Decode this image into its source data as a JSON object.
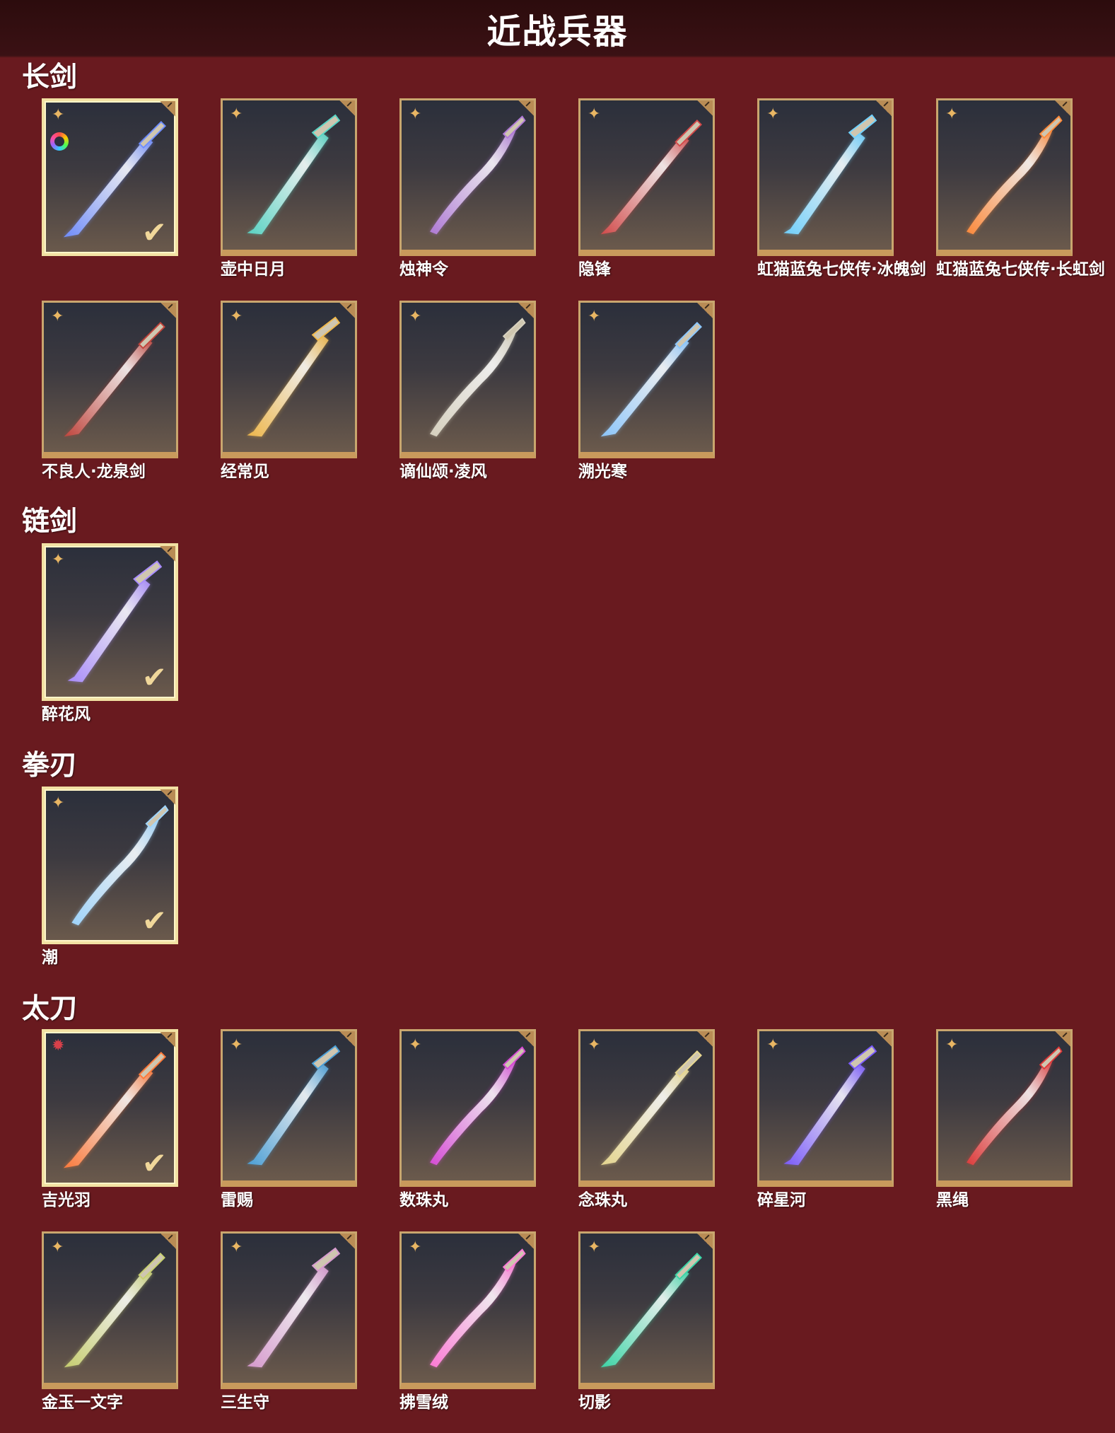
{
  "header": {
    "title": "近战兵器"
  },
  "sections": {
    "long_sword": {
      "title": "长剑",
      "items": [
        {
          "label": "",
          "selected": true,
          "icon": "blue-glowing-sword",
          "glow": "#6f8dff"
        },
        {
          "label": "壶中日月",
          "selected": false,
          "icon": "teal-jade-sword",
          "glow": "#58d6c6"
        },
        {
          "label": "烛神令",
          "selected": false,
          "icon": "purple-curved-sword",
          "glow": "#b07ad8"
        },
        {
          "label": "隐锋",
          "selected": false,
          "icon": "red-hilt-sword",
          "glow": "#d44a4a"
        },
        {
          "label": "虹猫蓝兔七侠传·冰魄剑",
          "selected": false,
          "icon": "ice-blue-sword",
          "glow": "#6fd2ff"
        },
        {
          "label": "虹猫蓝兔七侠传·长虹剑",
          "selected": false,
          "icon": "orange-flame-sword",
          "glow": "#ff8a3a"
        },
        {
          "label": "不良人·龙泉剑",
          "selected": false,
          "icon": "dark-red-sword",
          "glow": "#c2443c"
        },
        {
          "label": "经常见",
          "selected": false,
          "icon": "golden-sword",
          "glow": "#f0b84a"
        },
        {
          "label": "谪仙颂·凌风",
          "selected": false,
          "icon": "silver-sword",
          "glow": "#d8d2c0"
        },
        {
          "label": "溯光寒",
          "selected": false,
          "icon": "crystal-ice-sword",
          "glow": "#8cc8ff"
        }
      ]
    },
    "chain_sword": {
      "title": "链剑",
      "items": [
        {
          "label": "醉花风",
          "selected": true,
          "icon": "violet-chain-sword",
          "glow": "#a98cff"
        }
      ]
    },
    "fist_blade": {
      "title": "拳刃",
      "items": [
        {
          "label": "潮",
          "selected": true,
          "icon": "crystal-claw",
          "glow": "#9fd6ff"
        }
      ]
    },
    "katana": {
      "title": "太刀",
      "items": [
        {
          "label": "吉光羽",
          "selected": true,
          "icon": "flame-feather-katana",
          "glow": "#ff7a3a",
          "red_star": true
        },
        {
          "label": "雷赐",
          "selected": false,
          "icon": "blue-gold-katana",
          "glow": "#4aa0d8"
        },
        {
          "label": "数珠丸",
          "selected": false,
          "icon": "magenta-katana",
          "glow": "#d84ad8"
        },
        {
          "label": "念珠丸",
          "selected": false,
          "icon": "white-gold-katana",
          "glow": "#e8d890"
        },
        {
          "label": "碎星河",
          "selected": false,
          "icon": "galaxy-katana",
          "glow": "#7a5aff"
        },
        {
          "label": "黑绳",
          "selected": false,
          "icon": "crimson-katana",
          "glow": "#e03a3a"
        },
        {
          "label": "金玉一文字",
          "selected": false,
          "icon": "jade-gold-katana",
          "glow": "#c8d070"
        },
        {
          "label": "三生守",
          "selected": false,
          "icon": "silver-pink-katana",
          "glow": "#d89ad0"
        },
        {
          "label": "拂雪绒",
          "selected": false,
          "icon": "pink-white-katana",
          "glow": "#ff7ad8"
        },
        {
          "label": "切影",
          "selected": false,
          "icon": "teal-shadow-katana",
          "glow": "#3ad8a8"
        }
      ]
    }
  }
}
